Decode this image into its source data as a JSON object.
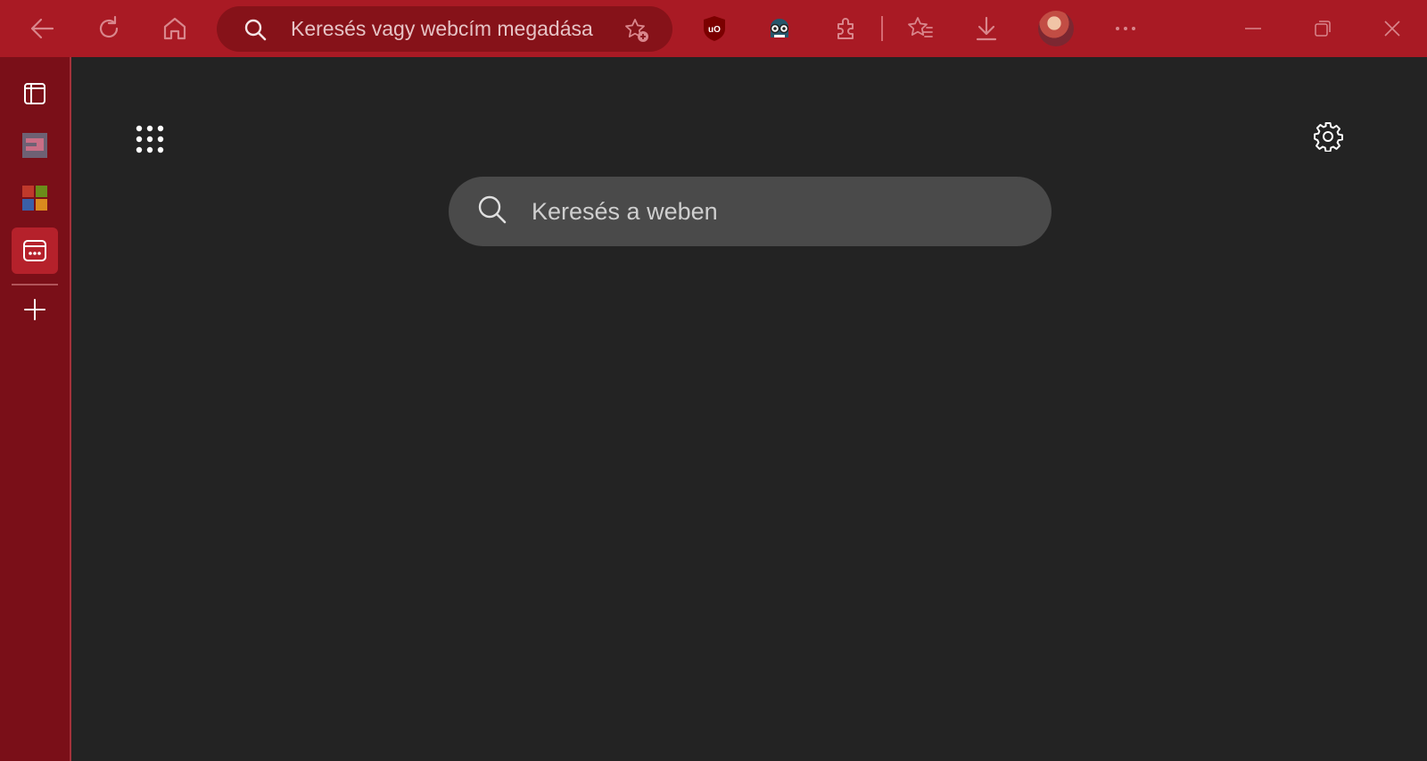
{
  "toolbar": {
    "address_placeholder": "Keresés vagy webcím megadása",
    "buttons": [
      "back-icon",
      "refresh-icon",
      "home-icon",
      "favorite-add-icon",
      "ublock-icon",
      "extension-glasses-icon",
      "extensions-icon",
      "favorites-icon",
      "downloads-icon",
      "profile-avatar",
      "more-icon",
      "minimize-icon",
      "restore-icon",
      "close-icon"
    ]
  },
  "sidebar": {
    "items": [
      "vertical-tabs-icon",
      "workspace-icon",
      "office-icon",
      "collections-icon",
      "add-icon"
    ]
  },
  "newtab": {
    "search_placeholder": "Keresés a weben"
  },
  "colors": {
    "toolbar_bg": "#a91a24",
    "address_bg": "#861219",
    "sidebar_bg": "#7a0f18",
    "content_bg": "#232323",
    "search_bg": "#4a4a4a"
  }
}
